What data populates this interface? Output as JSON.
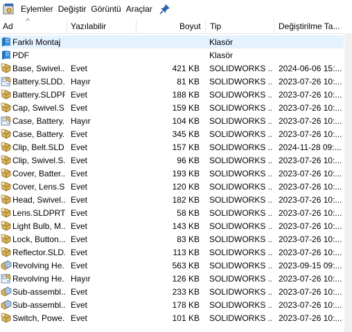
{
  "toolbar": {
    "menu": [
      "Eylemler",
      "Değiştir",
      "Görüntü",
      "Araçlar"
    ]
  },
  "columns": {
    "name": "Ad",
    "writable": "Yazılabilir",
    "size": "Boyut",
    "type": "Tip",
    "modified": "Değiştirilme Ta..."
  },
  "rows": [
    {
      "icon": "folder-icon",
      "name": "Farklı Montaj",
      "writable": "",
      "size": "",
      "type": "Klasör",
      "modified": ""
    },
    {
      "icon": "folder-icon",
      "name": "PDF",
      "writable": "",
      "size": "",
      "type": "Klasör",
      "modified": ""
    },
    {
      "icon": "part-icon",
      "name": "Base, Swivel....",
      "writable": "Evet",
      "size": "421 KB",
      "type": "SOLIDWORKS ...",
      "modified": "2024-06-06 15:..."
    },
    {
      "icon": "drawing-icon",
      "name": "Battery.SLDD...",
      "writable": "Hayır",
      "size": "81 KB",
      "type": "SOLIDWORKS ...",
      "modified": "2023-07-26 10:..."
    },
    {
      "icon": "part-icon",
      "name": "Battery.SLDPRT",
      "writable": "Evet",
      "size": "188 KB",
      "type": "SOLIDWORKS ...",
      "modified": "2023-07-26 10:..."
    },
    {
      "icon": "part-icon",
      "name": "Cap, Swivel.S...",
      "writable": "Evet",
      "size": "159 KB",
      "type": "SOLIDWORKS ...",
      "modified": "2023-07-26 10:..."
    },
    {
      "icon": "drawing-icon",
      "name": "Case, Battery....",
      "writable": "Hayır",
      "size": "104 KB",
      "type": "SOLIDWORKS ...",
      "modified": "2023-07-26 10:..."
    },
    {
      "icon": "part-icon",
      "name": "Case, Battery....",
      "writable": "Evet",
      "size": "345 KB",
      "type": "SOLIDWORKS ...",
      "modified": "2023-07-26 10:..."
    },
    {
      "icon": "part-icon",
      "name": "Clip, Belt.SLD...",
      "writable": "Evet",
      "size": "157 KB",
      "type": "SOLIDWORKS ...",
      "modified": "2024-11-28 09:..."
    },
    {
      "icon": "part-icon",
      "name": "Clip, Swivel.S...",
      "writable": "Evet",
      "size": "96 KB",
      "type": "SOLIDWORKS ...",
      "modified": "2023-07-26 10:..."
    },
    {
      "icon": "part-icon",
      "name": "Cover, Batter....",
      "writable": "Evet",
      "size": "193 KB",
      "type": "SOLIDWORKS ...",
      "modified": "2023-07-26 10:..."
    },
    {
      "icon": "part-icon",
      "name": "Cover, Lens.S...",
      "writable": "Evet",
      "size": "120 KB",
      "type": "SOLIDWORKS ...",
      "modified": "2023-07-26 10:..."
    },
    {
      "icon": "part-icon",
      "name": "Head, Swivel....",
      "writable": "Evet",
      "size": "182 KB",
      "type": "SOLIDWORKS ...",
      "modified": "2023-07-26 10:..."
    },
    {
      "icon": "part-icon",
      "name": "Lens.SLDPRT",
      "writable": "Evet",
      "size": "58 KB",
      "type": "SOLIDWORKS ...",
      "modified": "2023-07-26 10:..."
    },
    {
      "icon": "part-icon",
      "name": "Light Bulb, M...",
      "writable": "Evet",
      "size": "143 KB",
      "type": "SOLIDWORKS ...",
      "modified": "2023-07-26 10:..."
    },
    {
      "icon": "part-icon",
      "name": "Lock, Button....",
      "writable": "Evet",
      "size": "83 KB",
      "type": "SOLIDWORKS ...",
      "modified": "2023-07-26 10:..."
    },
    {
      "icon": "part-icon",
      "name": "Reflector.SLD...",
      "writable": "Evet",
      "size": "113 KB",
      "type": "SOLIDWORKS ...",
      "modified": "2023-07-26 10:..."
    },
    {
      "icon": "assembly-icon",
      "name": "Revolving He...",
      "writable": "Evet",
      "size": "563 KB",
      "type": "SOLIDWORKS ...",
      "modified": "2023-09-15 09:..."
    },
    {
      "icon": "drawing-icon",
      "name": "Revolving He...",
      "writable": "Hayır",
      "size": "126 KB",
      "type": "SOLIDWORKS ...",
      "modified": "2023-07-26 10:..."
    },
    {
      "icon": "assembly-icon",
      "name": "Sub-assembl...",
      "writable": "Evet",
      "size": "233 KB",
      "type": "SOLIDWORKS ...",
      "modified": "2023-07-26 10:..."
    },
    {
      "icon": "assembly-icon",
      "name": "Sub-assembl...",
      "writable": "Evet",
      "size": "178 KB",
      "type": "SOLIDWORKS ...",
      "modified": "2023-07-26 10:..."
    },
    {
      "icon": "part-icon",
      "name": "Switch, Powe...",
      "writable": "Evet",
      "size": "101 KB",
      "type": "SOLIDWORKS ...",
      "modified": "2023-07-26 10:..."
    }
  ],
  "selected_row": 0,
  "colors": {
    "selection": "#e5f3ff",
    "folder": "#1e73be",
    "part": "#d8b35a",
    "drawing": "#5a7fa8",
    "pin": "#2b62a8"
  }
}
